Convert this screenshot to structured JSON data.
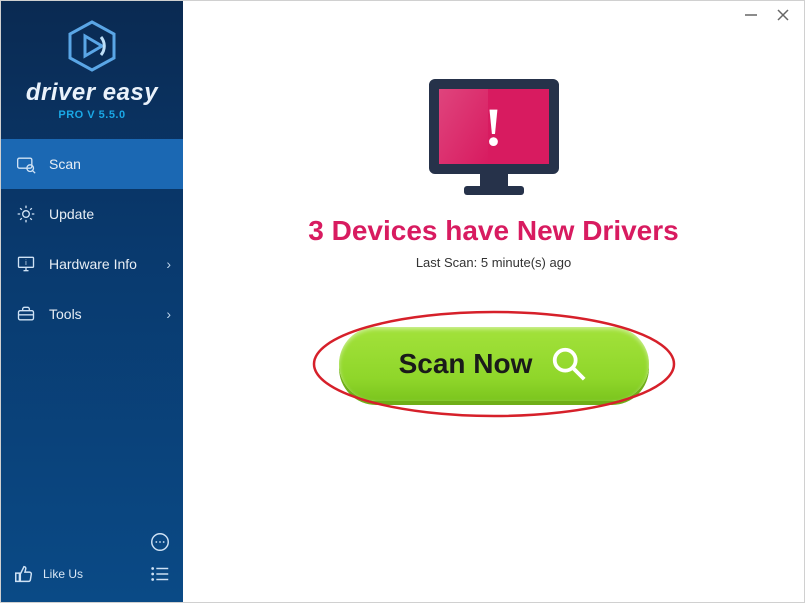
{
  "brand": {
    "name": "driver easy",
    "version_label": "PRO V 5.5.0"
  },
  "sidebar": {
    "items": [
      {
        "label": "Scan",
        "icon": "scan-icon",
        "has_chevron": false,
        "active": true
      },
      {
        "label": "Update",
        "icon": "gear-icon",
        "has_chevron": false,
        "active": false
      },
      {
        "label": "Hardware Info",
        "icon": "monitor-info-icon",
        "has_chevron": true,
        "active": false
      },
      {
        "label": "Tools",
        "icon": "toolbox-icon",
        "has_chevron": true,
        "active": false
      }
    ],
    "like_us_label": "Like Us"
  },
  "main": {
    "headline": "3 Devices have New Drivers",
    "last_scan": "Last Scan: 5 minute(s) ago",
    "scan_button_label": "Scan Now"
  },
  "colors": {
    "accent_pink": "#d81b60",
    "sidebar_top": "#0a2a52",
    "sidebar_bottom": "#0a4a86",
    "button_green": "#8fd62a"
  }
}
